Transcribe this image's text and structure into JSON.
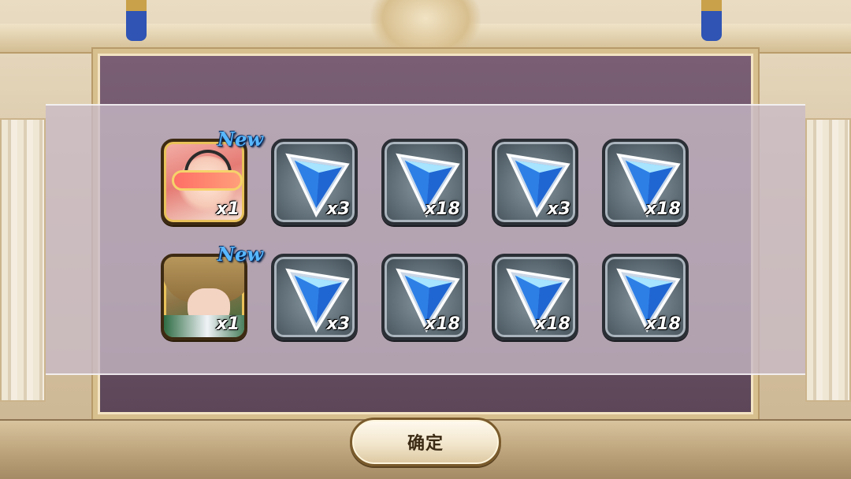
{
  "rewards": {
    "rows": [
      [
        {
          "type": "character",
          "portrait": "pink-hair-masked-girl",
          "badge": "New",
          "quantity": "x1"
        },
        {
          "type": "crystal",
          "icon": "blue-crystal-icon",
          "quantity": "x3"
        },
        {
          "type": "crystal",
          "icon": "blue-crystal-icon",
          "quantity": "x18"
        },
        {
          "type": "crystal",
          "icon": "blue-crystal-icon",
          "quantity": "x3"
        },
        {
          "type": "crystal",
          "icon": "blue-crystal-icon",
          "quantity": "x18"
        }
      ],
      [
        {
          "type": "character",
          "portrait": "brown-hair-boy",
          "badge": "New",
          "quantity": "x1"
        },
        {
          "type": "crystal",
          "icon": "blue-crystal-icon",
          "quantity": "x3"
        },
        {
          "type": "crystal",
          "icon": "blue-crystal-icon",
          "quantity": "x18"
        },
        {
          "type": "crystal",
          "icon": "blue-crystal-icon",
          "quantity": "x18"
        },
        {
          "type": "crystal",
          "icon": "blue-crystal-icon",
          "quantity": "x18"
        }
      ]
    ]
  },
  "buttons": {
    "confirm_label": "确定"
  },
  "colors": {
    "new_badge": "#58b8ff",
    "panel": "#c8bac6",
    "frame": "#d7bf8e"
  }
}
